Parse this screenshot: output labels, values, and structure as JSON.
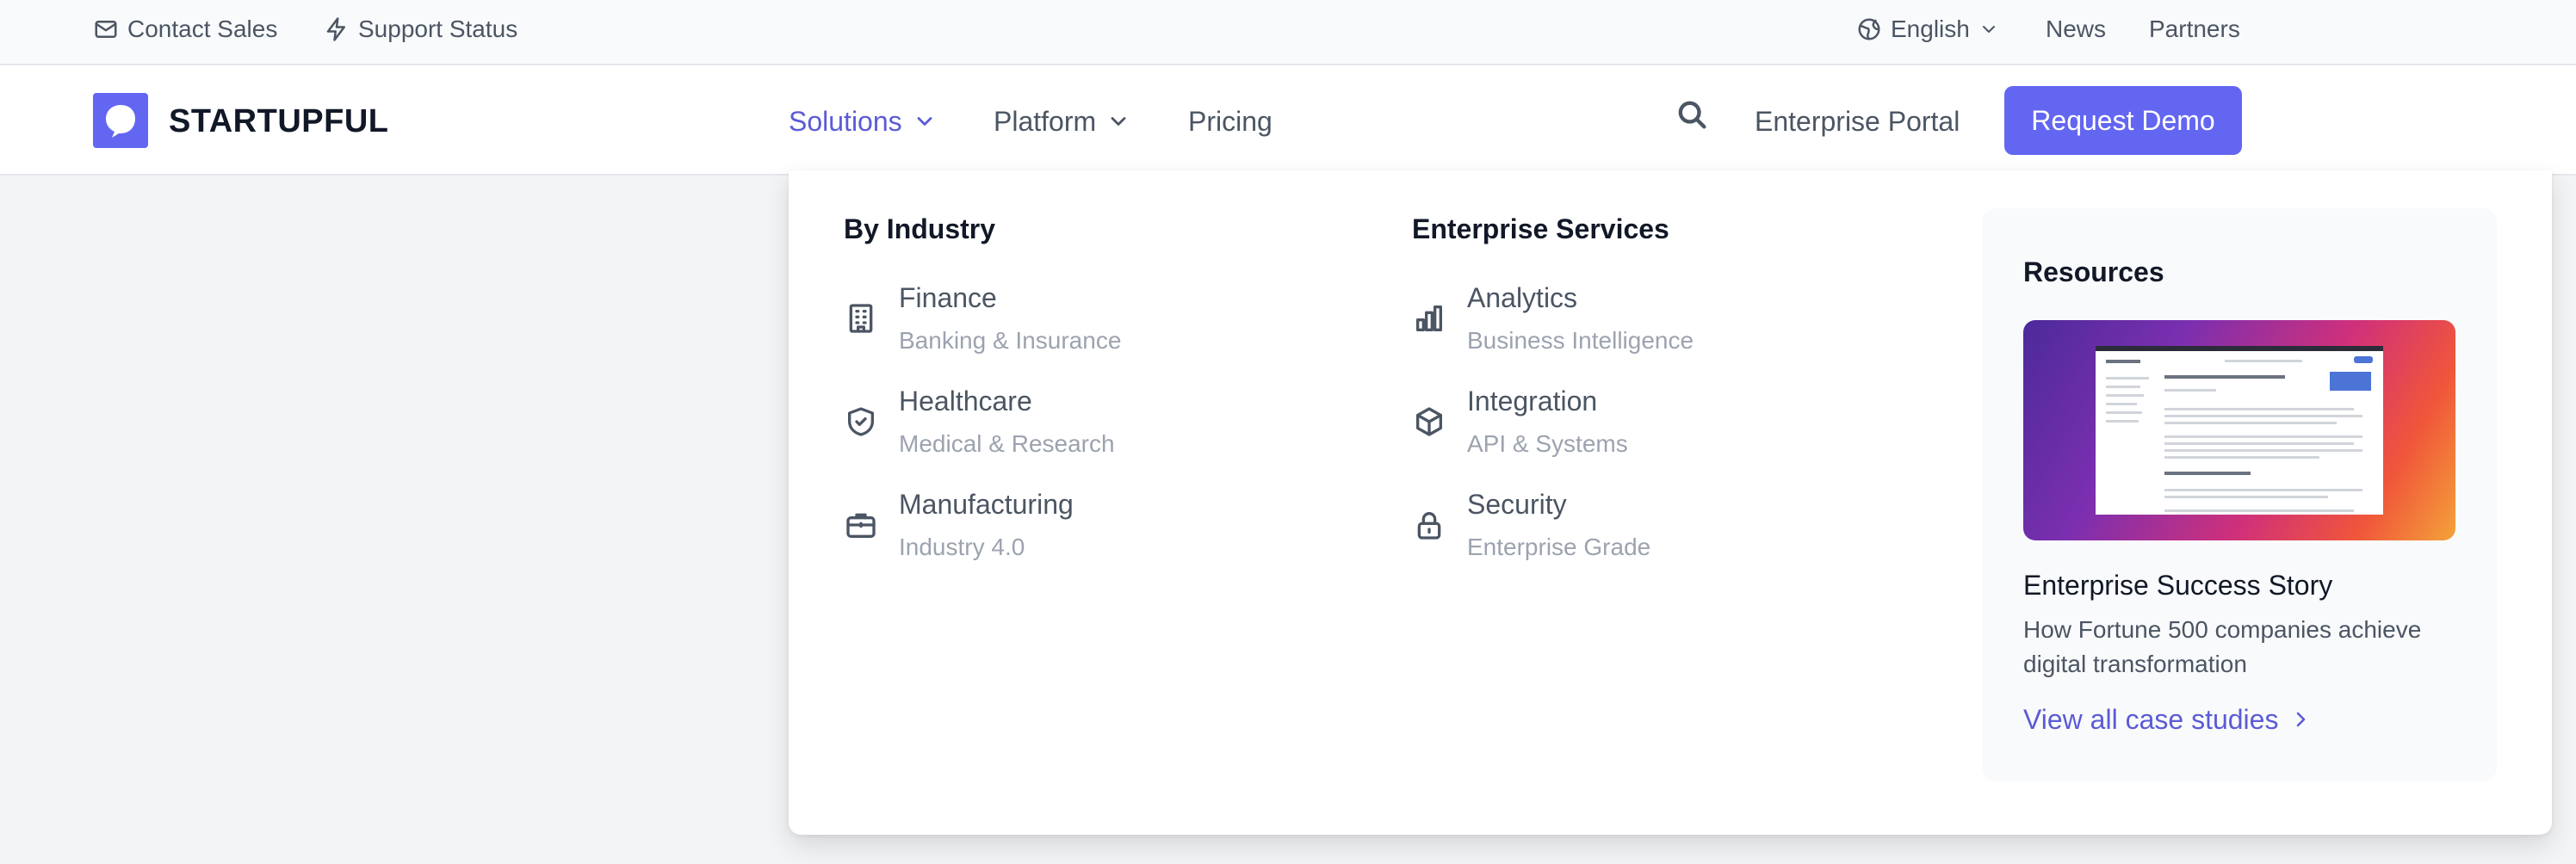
{
  "topbar": {
    "contact_sales": "Contact Sales",
    "support_status": "Support Status",
    "language": "English",
    "news": "News",
    "partners": "Partners"
  },
  "header": {
    "brand": "STARTUPFUL",
    "nav": {
      "solutions": "Solutions",
      "platform": "Platform",
      "pricing": "Pricing"
    },
    "enterprise_portal": "Enterprise Portal",
    "request_demo": "Request Demo"
  },
  "mega_menu": {
    "by_industry": {
      "title": "By Industry",
      "items": [
        {
          "title": "Finance",
          "subtitle": "Banking & Insurance",
          "icon": "building-icon"
        },
        {
          "title": "Healthcare",
          "subtitle": "Medical & Research",
          "icon": "shield-check-icon"
        },
        {
          "title": "Manufacturing",
          "subtitle": "Industry 4.0",
          "icon": "briefcase-icon"
        }
      ]
    },
    "enterprise_services": {
      "title": "Enterprise Services",
      "items": [
        {
          "title": "Analytics",
          "subtitle": "Business Intelligence",
          "icon": "bar-chart-icon"
        },
        {
          "title": "Integration",
          "subtitle": "API & Systems",
          "icon": "cube-icon"
        },
        {
          "title": "Security",
          "subtitle": "Enterprise Grade",
          "icon": "lock-icon"
        }
      ]
    },
    "resources": {
      "title": "Resources",
      "story_title": "Enterprise Success Story",
      "story_desc": "How Fortune 500 companies achieve digital transformation",
      "link": "View all case studies"
    }
  },
  "colors": {
    "accent": "#6366f1",
    "accent_text": "#5b5bd6",
    "text": "#111827",
    "muted": "#4b5563",
    "subtle": "#9ca3af",
    "background": "#f3f4f6"
  }
}
